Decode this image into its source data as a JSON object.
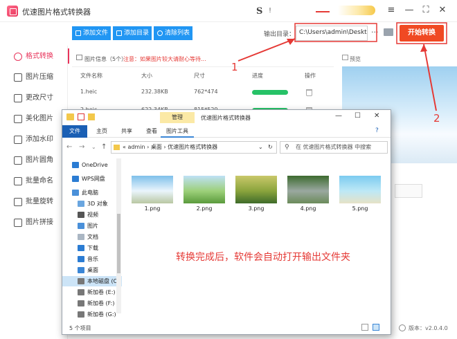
{
  "app": {
    "title": "优速图片格式转换器",
    "brand_mark": "S",
    "brand_suffix": "!",
    "window_controls": [
      "≡",
      "—",
      "⛶",
      "✕"
    ]
  },
  "toolbar": {
    "add_file": "添加文件",
    "add_folder": "添加目录",
    "clear_list": "清除列表",
    "output_label": "输出目录：",
    "output_path": "C:\\Users\\admin\\Deskto",
    "more": "···",
    "start": "开始转换"
  },
  "sidebar": {
    "items": [
      {
        "label": "格式转换",
        "active": true
      },
      {
        "label": "图片压缩",
        "active": false
      },
      {
        "label": "更改尺寸",
        "active": false
      },
      {
        "label": "美化图片",
        "active": false
      },
      {
        "label": "添加水印",
        "active": false
      },
      {
        "label": "图片圆角",
        "active": false
      },
      {
        "label": "批量命名",
        "active": false
      },
      {
        "label": "批量旋转",
        "active": false
      },
      {
        "label": "图片拼接",
        "active": false
      }
    ]
  },
  "files": {
    "header_title": "图片信息（5个）",
    "header_note": "注意：如果图片较大请耐心等待...",
    "columns": [
      "文件名称",
      "大小",
      "尺寸",
      "进度",
      "操作"
    ],
    "rows": [
      {
        "name": "1.heic",
        "size": "232.38KB",
        "dims": "762*474",
        "progress": 1.0
      },
      {
        "name": "2.heic",
        "size": "622.34KB",
        "dims": "815*529",
        "progress": 1.0
      }
    ]
  },
  "preview": {
    "label": "预览"
  },
  "version": "版本：v2.0.4.0",
  "annotations": {
    "one": "1",
    "two": "2"
  },
  "explorer": {
    "title": "优速图片格式转换器",
    "context_group": "管理",
    "ribbon_tabs": [
      "文件",
      "主页",
      "共享",
      "查看",
      "图片工具"
    ],
    "window_controls": [
      "—",
      "☐",
      "✕"
    ],
    "address": [
      "admin",
      "桌面",
      "优速图片格式转换器"
    ],
    "address_prefix": "«",
    "search_placeholder": "在 优速图片格式转换器 中搜索",
    "tree": [
      {
        "label": "OneDrive",
        "icon": "cloud-icon"
      },
      {
        "label": "WPS网盘",
        "icon": "cloud-icon"
      },
      {
        "label": "此电脑",
        "icon": "computer-icon"
      },
      {
        "label": "3D 对象",
        "icon": "cube-icon"
      },
      {
        "label": "视频",
        "icon": "video-icon"
      },
      {
        "label": "图片",
        "icon": "image-icon"
      },
      {
        "label": "文档",
        "icon": "document-icon"
      },
      {
        "label": "下载",
        "icon": "download-icon"
      },
      {
        "label": "音乐",
        "icon": "music-icon"
      },
      {
        "label": "桌面",
        "icon": "desktop-icon"
      },
      {
        "label": "本地磁盘 (C",
        "icon": "drive-icon"
      },
      {
        "label": "新加卷 (E:)",
        "icon": "drive-icon"
      },
      {
        "label": "新加卷 (F:)",
        "icon": "drive-icon"
      },
      {
        "label": "新加卷 (G:)",
        "icon": "drive-icon"
      }
    ],
    "files": [
      {
        "name": "1.png",
        "colors": [
          "#7ec0ea",
          "#eaf5fc",
          "#b9c7a3"
        ]
      },
      {
        "name": "2.png",
        "colors": [
          "#bfe1f6",
          "#9dd07a",
          "#5a9a3c"
        ]
      },
      {
        "name": "3.png",
        "colors": [
          "#c9c86a",
          "#8aa43d",
          "#3f6b2a"
        ]
      },
      {
        "name": "4.png",
        "colors": [
          "#3d6b2f",
          "#9aa8a0",
          "#6b8b5a"
        ]
      },
      {
        "name": "5.png",
        "colors": [
          "#7ccbf0",
          "#bde8f6",
          "#e6e2c6"
        ]
      }
    ],
    "note": "转换完成后，软件会自动打开输出文件夹",
    "status": "5 个项目"
  }
}
